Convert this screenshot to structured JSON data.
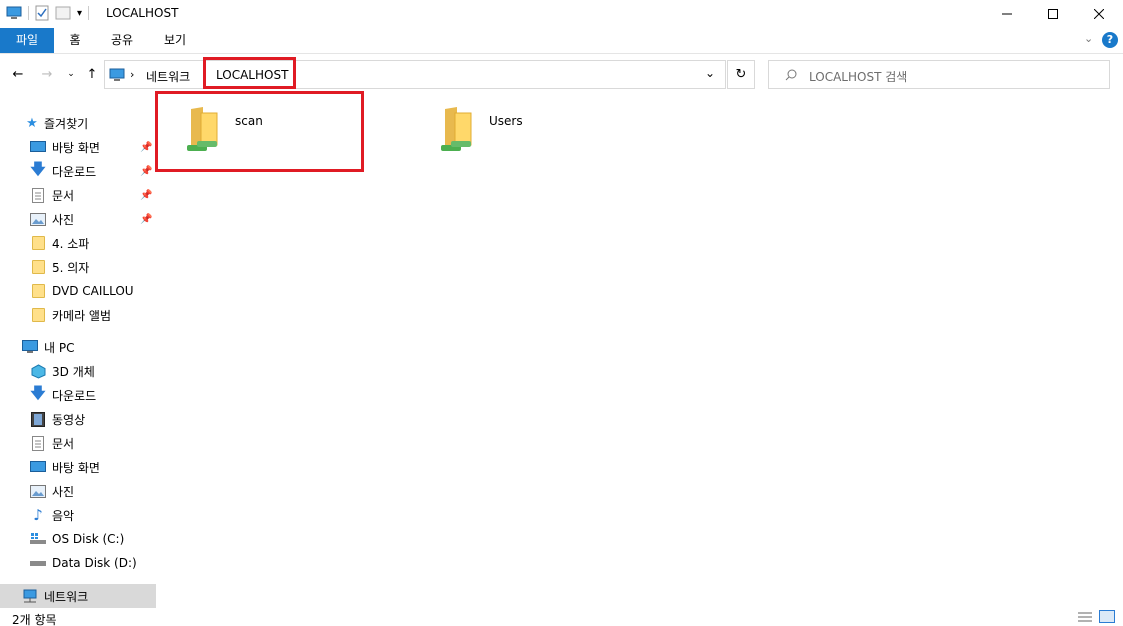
{
  "window": {
    "title": "LOCALHOST"
  },
  "ribbon": {
    "tabs": [
      "파일",
      "홈",
      "공유",
      "보기"
    ]
  },
  "address": {
    "crumbs": [
      "네트워크",
      "LOCALHOST"
    ],
    "search_placeholder": "LOCALHOST 검색"
  },
  "sidebar": {
    "quick_access": "즐겨찾기",
    "quick_items": [
      "바탕 화면",
      "다운로드",
      "문서",
      "사진",
      "4. 소파",
      "5. 의자",
      "DVD CAILLOU",
      "카메라 앨범"
    ],
    "this_pc": "내 PC",
    "pc_items": [
      "3D 개체",
      "다운로드",
      "동영상",
      "문서",
      "바탕 화면",
      "사진",
      "음악",
      "OS Disk (C:)",
      "Data Disk (D:)"
    ],
    "network": "네트워크"
  },
  "content": {
    "items": [
      "scan",
      "Users"
    ]
  },
  "status": {
    "count": "2개 항목"
  },
  "colors": {
    "accent": "#1979ca",
    "highlight": "#e01b24",
    "selected": "#d9d9d9"
  }
}
